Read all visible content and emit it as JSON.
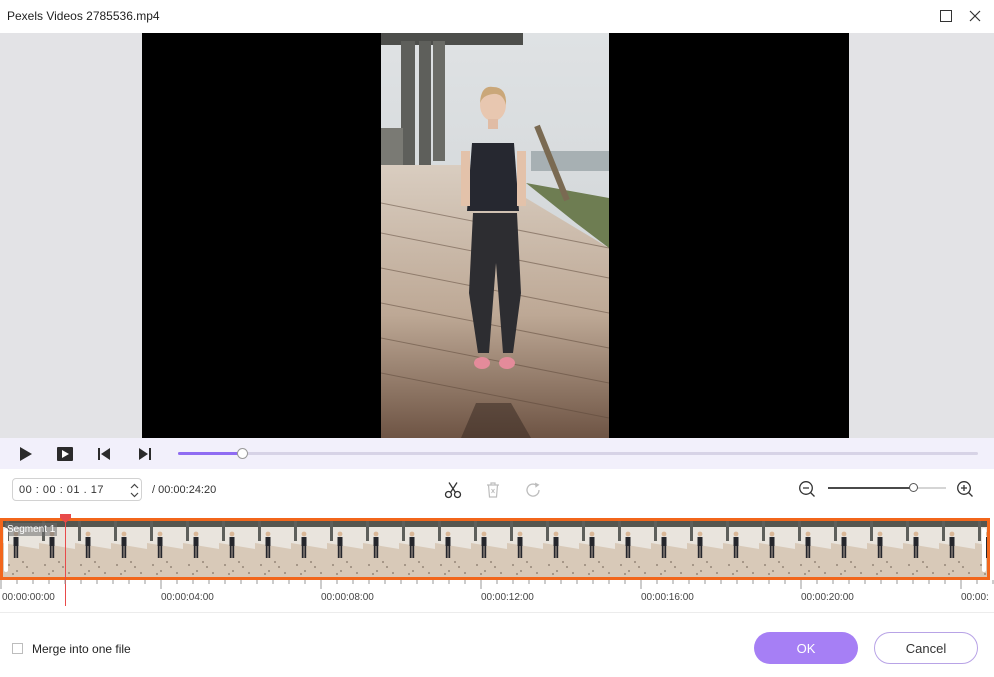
{
  "window": {
    "title": "Pexels Videos 2785536.mp4",
    "icons": {
      "maximize": "maximize-icon",
      "close": "close-icon"
    }
  },
  "player": {
    "controls": [
      "play-icon",
      "stop-icon",
      "previous-frame-icon",
      "next-frame-icon"
    ],
    "progress_fraction": 0.08,
    "accent_color": "#8f6cf2"
  },
  "time": {
    "current": "00 : 00 : 01 . 17",
    "total": "/ 00:00:24:20"
  },
  "tools": {
    "icons": [
      "scissors-icon",
      "delete-icon",
      "refresh-icon"
    ],
    "zoom_level_fraction": 0.72,
    "zoom_icons": [
      "zoom-out-icon",
      "zoom-in-icon"
    ]
  },
  "timeline": {
    "segment_label": "Segment 1",
    "segment_color": "#f2661b",
    "playhead_color": "#e84a4a",
    "ruler_labels": [
      "00:00:00:00",
      "00:00:04:00",
      "00:00:08:00",
      "00:00:12:00",
      "00:00:16:00",
      "00:00:20:00",
      "00:00:"
    ]
  },
  "footer": {
    "merge_label": "Merge into one file",
    "merge_checked": false,
    "ok_label": "OK",
    "cancel_label": "Cancel"
  }
}
